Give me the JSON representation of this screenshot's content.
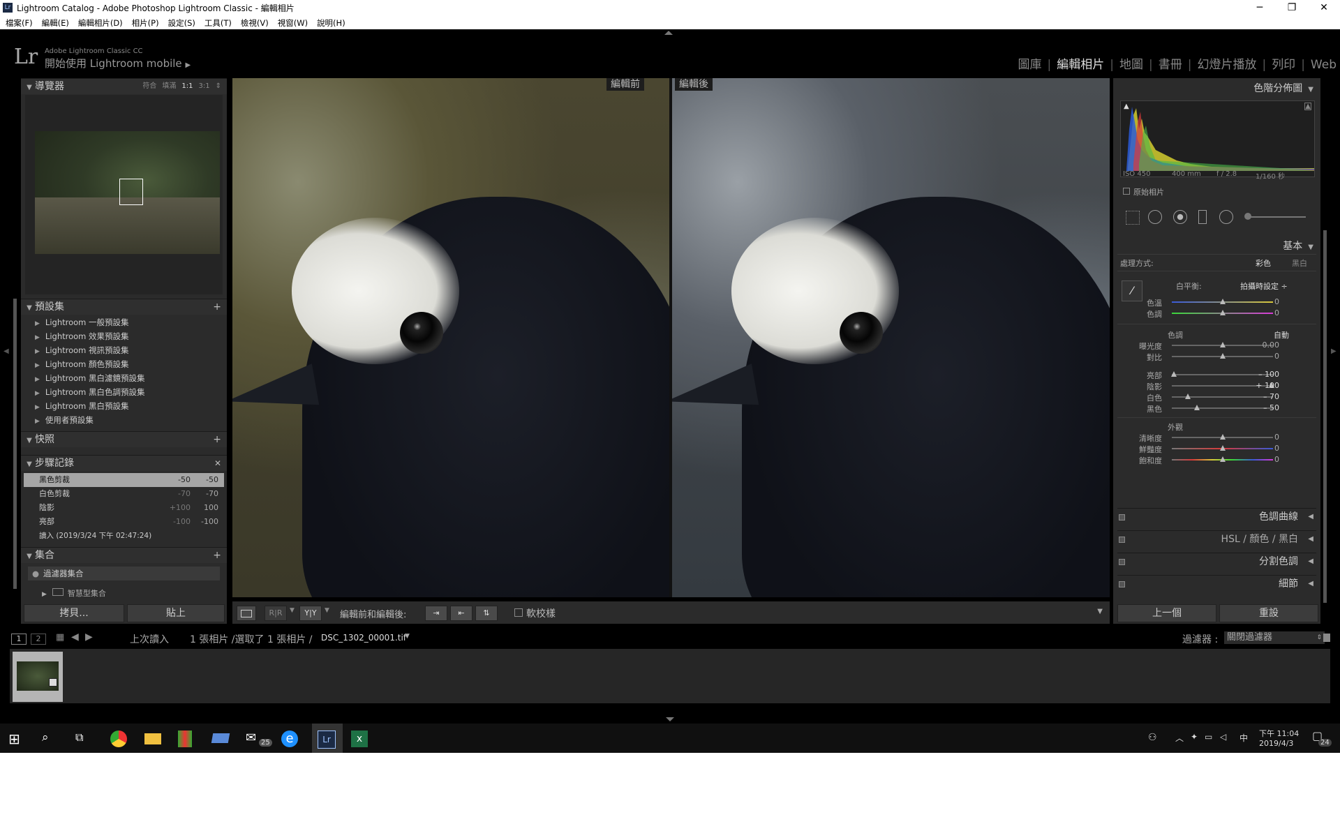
{
  "window": {
    "title": "Lightroom Catalog - Adobe Photoshop Lightroom Classic - 編輯相片",
    "minimize": "─",
    "maximize": "❐",
    "close": "✕"
  },
  "menu": [
    "檔案(F)",
    "編輯(E)",
    "編輯相片(D)",
    "相片(P)",
    "設定(S)",
    "工具(T)",
    "檢視(V)",
    "視窗(W)",
    "說明(H)"
  ],
  "identity": {
    "logo": "Lr",
    "product": "Adobe Lightroom Classic CC",
    "mobile": "開始使用 Lightroom mobile",
    "mobile_arrow": "▶"
  },
  "modules": [
    {
      "label": "圖庫"
    },
    {
      "label": "編輯相片",
      "active": true
    },
    {
      "label": "地圖"
    },
    {
      "label": "書冊"
    },
    {
      "label": "幻燈片播放"
    },
    {
      "label": "列印"
    },
    {
      "label": "Web"
    }
  ],
  "left": {
    "navigator": {
      "title": "導覽器",
      "opts": [
        "符合",
        "填滿",
        "1:1",
        "3:1"
      ],
      "opt_arrow": "⇕"
    },
    "presets": {
      "title": "預設集",
      "items": [
        "Lightroom 一般預設集",
        "Lightroom 效果預設集",
        "Lightroom 視訊預設集",
        "Lightroom 顏色預設集",
        "Lightroom 黑白濾鏡預設集",
        "Lightroom 黑白色調預設集",
        "Lightroom 黑白預設集",
        "使用者預設集"
      ]
    },
    "snapshots": {
      "title": "快照"
    },
    "history": {
      "title": "步驟記錄",
      "close": "✕",
      "items": [
        {
          "label": "黑色剪裁",
          "v1": "-50",
          "v2": "-50"
        },
        {
          "label": "白色剪裁",
          "v1": "-70",
          "v2": "-70"
        },
        {
          "label": "陰影",
          "v1": "+100",
          "v2": "100"
        },
        {
          "label": "亮部",
          "v1": "-100",
          "v2": "-100"
        },
        {
          "label": "讀入 (2019/3/24 下午 02:47:24)",
          "v1": "",
          "v2": ""
        }
      ]
    },
    "collections": {
      "title": "集合",
      "filter": "過濾器集合",
      "smart": "智慧型集合"
    },
    "copy_btn": "拷貝...",
    "paste_btn": "貼上"
  },
  "main": {
    "before_label": "編輯前",
    "after_label": "編輯後"
  },
  "toolbar": {
    "view_ry": "R|R",
    "view_yy": "Y|Y",
    "before_after_label": "編輯前和編輯後:",
    "softproof_label": "軟校樣"
  },
  "right": {
    "histogram": {
      "title": "色階分佈圖",
      "iso": "ISO 450",
      "focal": "400 mm",
      "aperture": "f / 2.8",
      "shutter": "1/160 秒",
      "original": "原始相片"
    },
    "basic": {
      "title": "基本",
      "treatment_label": "處理方式:",
      "color": "彩色",
      "bw": "黑白",
      "wb_label": "白平衡:",
      "wb_value": "拍攝時設定 ÷",
      "sliders_wb": [
        {
          "label": "色溫",
          "value": "0",
          "pos": 0.5
        },
        {
          "label": "色調",
          "value": "0",
          "pos": 0.5
        }
      ],
      "tone_label": "色調",
      "auto": "自動",
      "sliders_tone1": [
        {
          "label": "曝光度",
          "value": "0.00",
          "pos": 0.5
        },
        {
          "label": "對比",
          "value": "0",
          "pos": 0.5
        }
      ],
      "sliders_tone2": [
        {
          "label": "亮部",
          "value": "– 100",
          "pos": 0.0
        },
        {
          "label": "陰影",
          "value": "+ 100",
          "pos": 1.0
        },
        {
          "label": "白色",
          "value": "– 70",
          "pos": 0.15
        },
        {
          "label": "黑色",
          "value": "– 50",
          "pos": 0.25
        }
      ],
      "presence_label": "外觀",
      "sliders_presence": [
        {
          "label": "清晰度",
          "value": "0",
          "pos": 0.5
        },
        {
          "label": "鮮豔度",
          "value": "0",
          "pos": 0.5
        },
        {
          "label": "飽和度",
          "value": "0",
          "pos": 0.5
        }
      ]
    },
    "collapsed": [
      {
        "label": "色調曲線"
      },
      {
        "label": "HSL  /  顏色  /  黑白"
      },
      {
        "label": "分割色調"
      },
      {
        "label": "細節"
      }
    ],
    "prev_btn": "上一個",
    "reset_btn": "重設"
  },
  "filmstrip": {
    "page1": "1",
    "page2": "2",
    "source": "上次讀入",
    "count": "1 張相片 /選取了 1 張相片 /",
    "filename": "DSC_1302_00001.tif",
    "filter_label": "過濾器 :",
    "filter_value": "關閉過濾器"
  },
  "taskbar": {
    "time": "下午 11:04",
    "date": "2019/4/3",
    "ime": "中",
    "mail_badge": "25",
    "notif_badge": "24"
  }
}
